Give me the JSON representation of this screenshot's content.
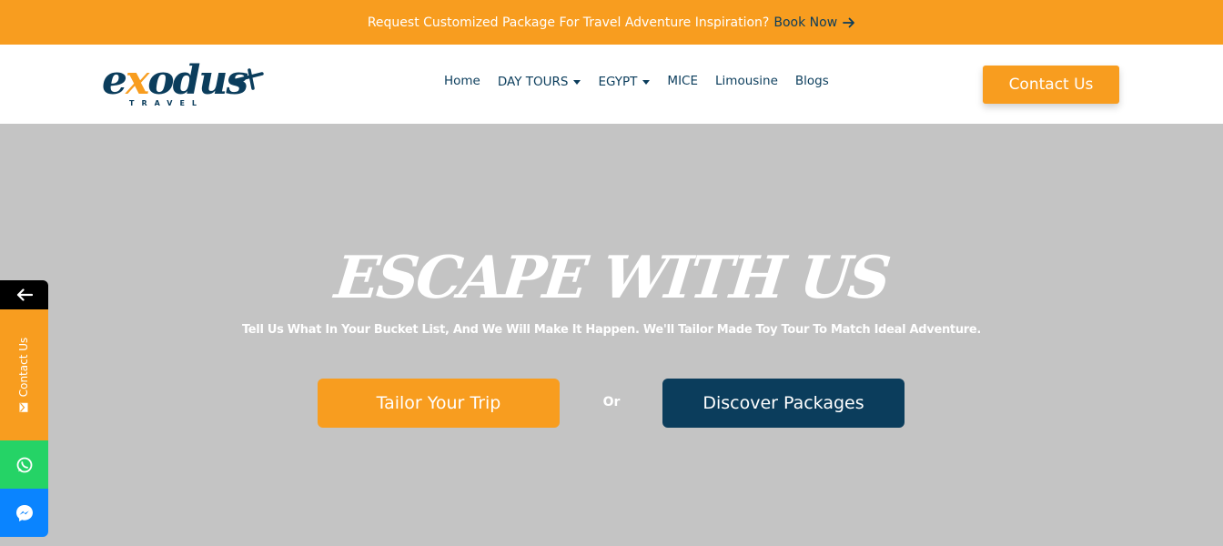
{
  "announcement": {
    "text": "Request Customized Package For Travel Adventure Inspiration?",
    "link_label": "Book Now",
    "link_icon": "arrow-right-icon"
  },
  "header": {
    "logo": {
      "word": "odus",
      "x_letter": "x",
      "e_letter": "e",
      "tagline": "TRAVEL"
    },
    "nav": [
      {
        "label": "Home",
        "has_dropdown": false
      },
      {
        "label": "DAY TOURS",
        "has_dropdown": true
      },
      {
        "label": "EGYPT",
        "has_dropdown": true
      },
      {
        "label": "MICE",
        "has_dropdown": false
      },
      {
        "label": "Limousine",
        "has_dropdown": false
      },
      {
        "label": "Blogs",
        "has_dropdown": false
      }
    ],
    "contact_button": "Contact Us"
  },
  "hero": {
    "title": "ESCAPE WITH US",
    "subtitle": "Tell Us What In Your Bucket List, And We Will Make It Happen. We'll Tailor Made Toy Tour To Match Ideal Adventure.",
    "primary_button": "Tailor Your Trip",
    "separator": "Or",
    "secondary_button": "Discover Packages"
  },
  "side_widget": {
    "toggle_icon": "arrow-left-icon",
    "contact_label": "Contact Us",
    "contact_icon": "mail-icon",
    "whatsapp_icon": "whatsapp-icon",
    "messenger_icon": "messenger-icon"
  },
  "colors": {
    "brand_orange": "#F89D1F",
    "brand_navy": "#0B3D5C",
    "hero_bg": "#C4C4C4",
    "whatsapp": "#25D366",
    "messenger": "#0A84FF"
  }
}
